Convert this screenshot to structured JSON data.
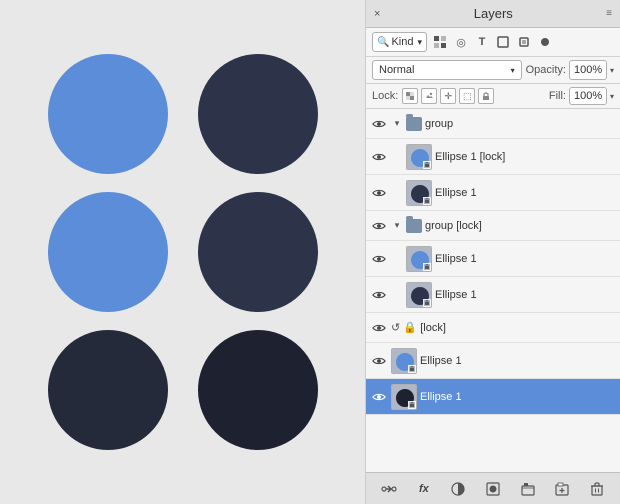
{
  "canvas": {
    "circles": [
      {
        "id": "row1-col1",
        "color": "blue",
        "label": "Blue circle top-left"
      },
      {
        "id": "row1-col2",
        "color": "dark1",
        "label": "Dark circle top-right"
      },
      {
        "id": "row2-col1",
        "color": "blue",
        "label": "Blue circle mid-left"
      },
      {
        "id": "row2-col2",
        "color": "dark1",
        "label": "Dark circle mid-right"
      },
      {
        "id": "row3-col1",
        "color": "dark2",
        "label": "Dark circle bottom-left"
      },
      {
        "id": "row3-col2",
        "color": "dark3",
        "label": "Dark circle bottom-right"
      }
    ]
  },
  "panel": {
    "title": "Layers",
    "close_icon": "×",
    "menu_icon": "≡",
    "filter": {
      "kind_label": "Kind",
      "dropdown_arrow": "▾"
    },
    "blend_mode": "Normal",
    "opacity_label": "Opacity:",
    "opacity_value": "100%",
    "lock_label": "Lock:",
    "fill_label": "Fill:",
    "fill_value": "100%",
    "layers": [
      {
        "id": "group1",
        "type": "group",
        "name": "group",
        "visible": true,
        "expanded": true,
        "indent": 0,
        "children": [
          {
            "id": "ellipse1-lock",
            "type": "layer",
            "name": "Ellipse 1 [lock]",
            "visible": true,
            "indent": 1,
            "thumb_blue": true
          },
          {
            "id": "ellipse1",
            "type": "layer",
            "name": "Ellipse 1",
            "visible": true,
            "indent": 1,
            "thumb_blue": false
          }
        ]
      },
      {
        "id": "group2",
        "type": "group",
        "name": "group [lock]",
        "visible": true,
        "expanded": true,
        "indent": 0,
        "children": [
          {
            "id": "ellipse1-a",
            "type": "layer",
            "name": "Ellipse 1",
            "visible": true,
            "indent": 1,
            "thumb_blue": true
          },
          {
            "id": "ellipse1-b",
            "type": "layer",
            "name": "Ellipse 1",
            "visible": true,
            "indent": 1,
            "thumb_blue": false
          }
        ]
      },
      {
        "id": "lock-group",
        "type": "special",
        "name": "[lock]",
        "visible": true,
        "indent": 0
      },
      {
        "id": "ellipse1-c",
        "type": "layer",
        "name": "Ellipse 1",
        "visible": true,
        "indent": 0,
        "thumb_blue": true,
        "selected": false
      },
      {
        "id": "ellipse1-d",
        "type": "layer",
        "name": "Ellipse 1",
        "visible": true,
        "indent": 0,
        "thumb_blue": false,
        "selected": true
      }
    ],
    "toolbar": {
      "link_label": "⛓",
      "fx_label": "fx",
      "adjust_label": "◑",
      "mask_label": "◻",
      "folder_label": "▣",
      "trash_label": "🗑",
      "new_layer_label": "+"
    }
  }
}
